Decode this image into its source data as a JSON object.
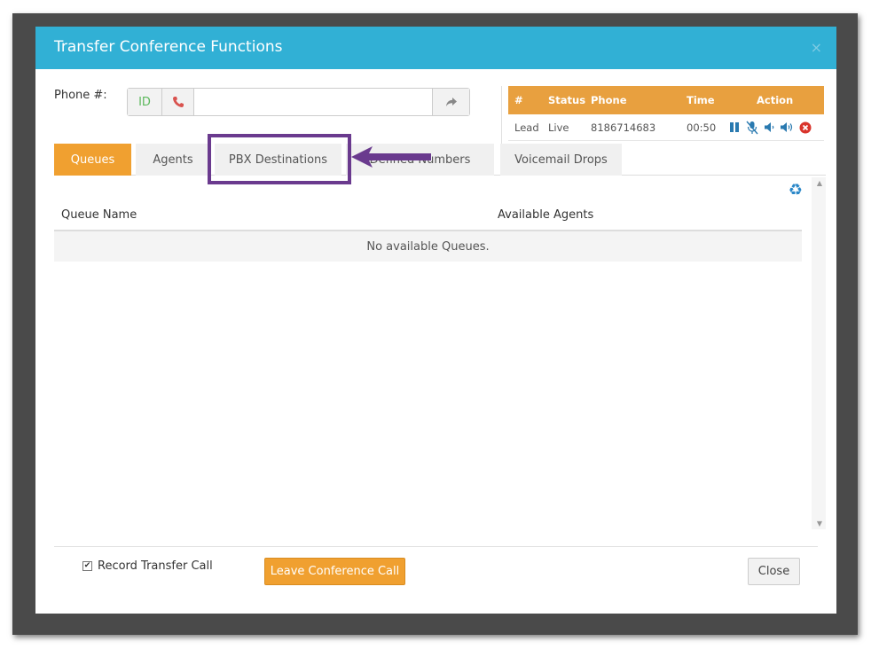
{
  "dialog": {
    "title": "Transfer Conference Functions",
    "close_glyph": "×"
  },
  "phone": {
    "label": "Phone #:",
    "id_addon": "ID",
    "value": "",
    "placeholder": ""
  },
  "calls": {
    "headers": [
      "#",
      "Status",
      "Phone",
      "Time",
      "Action"
    ],
    "rows": [
      {
        "type": "Lead",
        "status": "Live",
        "phone": "8186714683",
        "time": "00:50"
      }
    ],
    "action_icons": [
      "pause-icon",
      "mute-icon",
      "volume-down-icon",
      "volume-up-icon",
      "hangup-icon"
    ]
  },
  "tabs": [
    {
      "label": "Queues",
      "active": true
    },
    {
      "label": "Agents",
      "active": false
    },
    {
      "label": "PBX Destinations",
      "active": false
    },
    {
      "label": "Defined Numbers",
      "active": false
    },
    {
      "label": "Voicemail Drops",
      "active": false
    }
  ],
  "queue_table": {
    "headers": [
      "Queue Name",
      "Available Agents"
    ],
    "empty_message": "No available Queues."
  },
  "footer": {
    "record_label": "Record Transfer Call",
    "record_checked": true,
    "leave_button": "Leave Conference Call",
    "close_button": "Close"
  },
  "colors": {
    "header": "#31b0d5",
    "accent": "#f0a030",
    "annotation": "#6a3a8e"
  }
}
